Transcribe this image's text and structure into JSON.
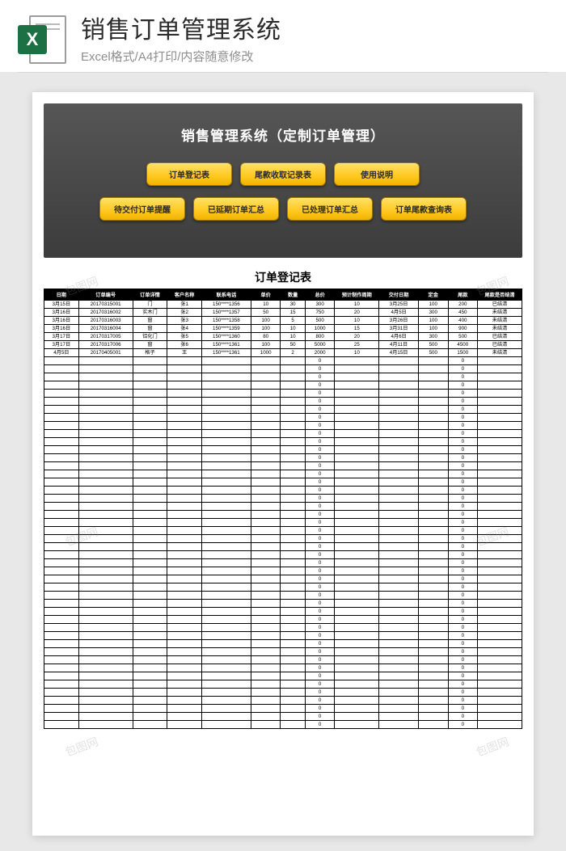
{
  "banner": {
    "icon_letter": "X",
    "title": "销售订单管理系统",
    "subtitle": "Excel格式/A4打印/内容随意修改"
  },
  "panel": {
    "title": "销售管理系统（定制订单管理）",
    "row1": [
      "订单登记表",
      "尾款收取记录表",
      "使用说明"
    ],
    "row2": [
      "待交付订单提醒",
      "已延期订单汇总",
      "已处理订单汇总",
      "订单尾款查询表"
    ]
  },
  "table": {
    "title": "订单登记表",
    "headers": [
      "日期",
      "订单编号",
      "订单详情",
      "客户名称",
      "联系电话",
      "单价",
      "数量",
      "总价",
      "预计制作周期",
      "交付日期",
      "定金",
      "尾款",
      "尾款是否结清"
    ],
    "rows": [
      [
        "3月15日",
        "20170315001",
        "门",
        "张1",
        "150****1356",
        "10",
        "30",
        "300",
        "10",
        "3月25日",
        "100",
        "200",
        "已结清"
      ],
      [
        "3月16日",
        "20170316002",
        "实木门",
        "张2",
        "150****1357",
        "50",
        "15",
        "750",
        "20",
        "4月5日",
        "300",
        "450",
        "未结清"
      ],
      [
        "3月16日",
        "20170316003",
        "窗",
        "张3",
        "150****1358",
        "100",
        "5",
        "500",
        "10",
        "3月26日",
        "100",
        "400",
        "未结清"
      ],
      [
        "3月16日",
        "20170316004",
        "窗",
        "张4",
        "150****1359",
        "100",
        "10",
        "1000",
        "15",
        "3月31日",
        "100",
        "900",
        "未结清"
      ],
      [
        "3月17日",
        "20170317005",
        "铝化门",
        "张5",
        "150****1360",
        "80",
        "10",
        "800",
        "20",
        "4月6日",
        "300",
        "500",
        "已结清"
      ],
      [
        "3月17日",
        "20170317006",
        "窗",
        "张6",
        "150****1361",
        "100",
        "50",
        "5000",
        "25",
        "4月11日",
        "500",
        "4500",
        "已结清"
      ],
      [
        "4月5日",
        "20170405001",
        "格子",
        "王",
        "150****1361",
        "1000",
        "2",
        "2000",
        "10",
        "4月15日",
        "500",
        "1500",
        "未结清"
      ]
    ],
    "empty_row_count": 46,
    "empty_defaults": {
      "col8": "0",
      "col12": "0"
    }
  },
  "watermark": "包图网"
}
